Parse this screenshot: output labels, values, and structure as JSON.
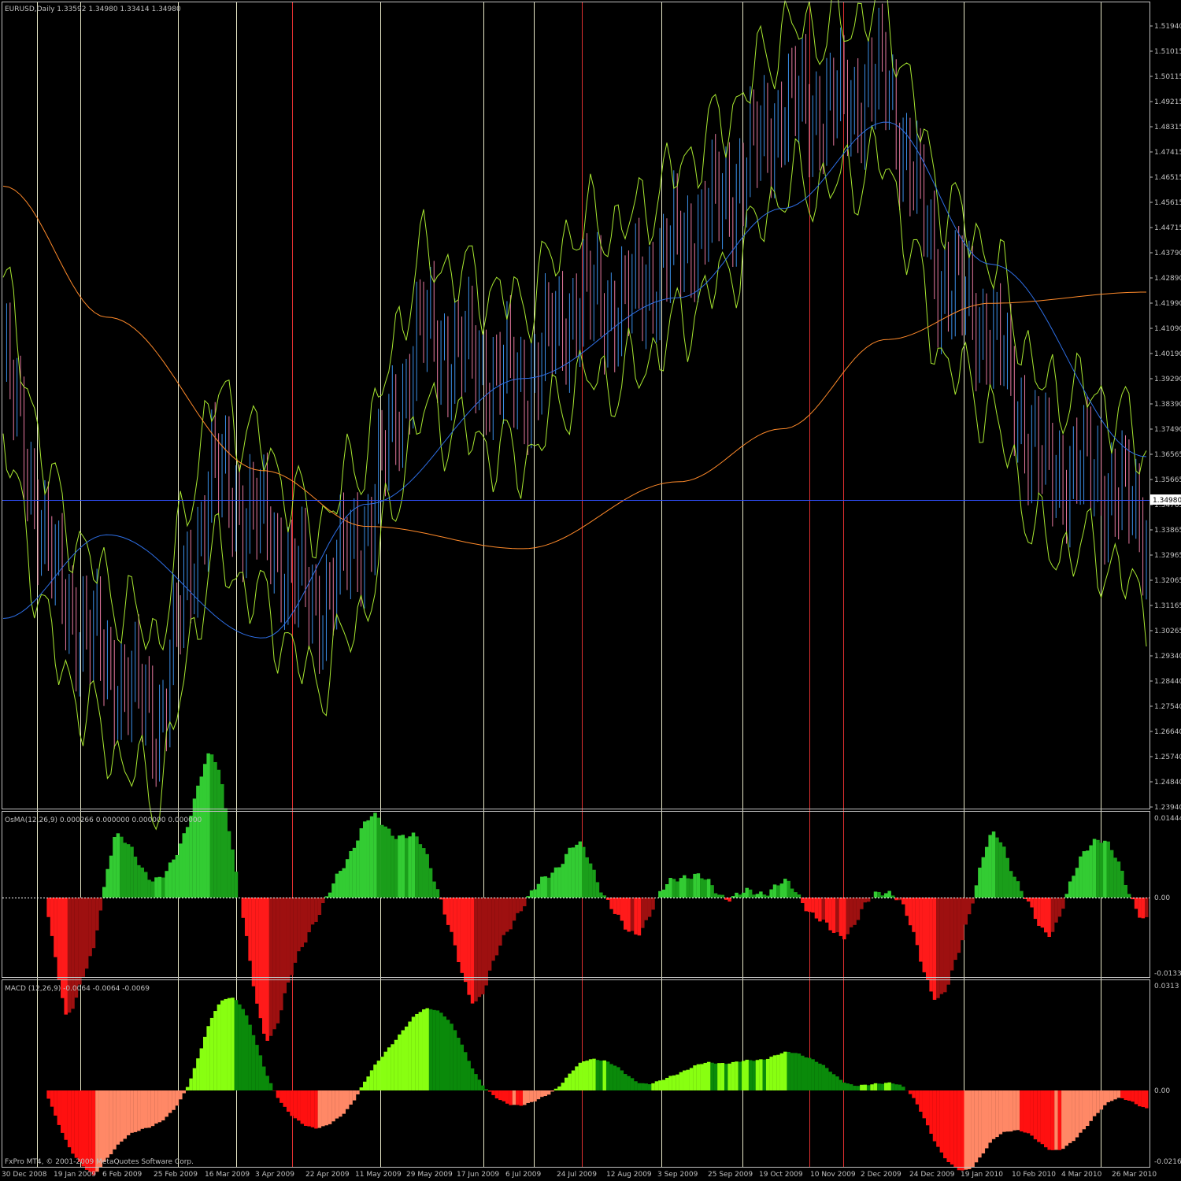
{
  "window": {
    "main_header": "EURUSD,Daily  1.33592 1.34980 1.33414 1.34980",
    "osma_header": "OsMA(12,26,9) 0.000266 0.000000 0.000000 0.000000",
    "macd_header": "MACD (12,26,9) -0.0064 -0.0064 -0.0069",
    "copyright": "FxPro MT4, © 2001-2009 MetaQuotes Software Corp.",
    "current_price": "1.34980"
  },
  "colors": {
    "background": "#000000",
    "frame": "#c0c0c0",
    "bull_candle": "#3b8fe8",
    "bear_candle": "#e87aa0",
    "envelope": "#a8e830",
    "ma_blue": "#2e6fe6",
    "ma_orange": "#ff8a2a",
    "vline_white": "#e8e8c8",
    "vline_red": "#e03030",
    "osma_pos": "#33cc33",
    "osma_pos_dark": "#1a9e1a",
    "osma_neg": "#ff1a1a",
    "osma_neg_dark": "#9e1010",
    "macd_pos": "#88ff11",
    "macd_pos_dark": "#0a8a0a",
    "macd_neg": "#ff1010",
    "macd_neg_light": "#ff8866",
    "price_line": "#3050ff"
  },
  "price_axis": [
    "1.51940",
    "1.51015",
    "1.50115",
    "1.49215",
    "1.48315",
    "1.47415",
    "1.46515",
    "1.45615",
    "1.44715",
    "1.43790",
    "1.42890",
    "1.41990",
    "1.41090",
    "1.40190",
    "1.39290",
    "1.38390",
    "1.37490",
    "1.36565",
    "1.35665",
    "1.34765",
    "1.33865",
    "1.32965",
    "1.32065",
    "1.31165",
    "1.30265",
    "1.29340",
    "1.28440",
    "1.27540",
    "1.26640",
    "1.25740",
    "1.24840",
    "1.23940"
  ],
  "osma_axis": [
    "0.01444",
    "0.00",
    "-0.01336"
  ],
  "macd_axis": [
    "0.0313",
    "0.00",
    "-0.0216"
  ],
  "time_axis": [
    "30 Dec 2008",
    "19 Jan 2009",
    "6 Feb 2009",
    "25 Feb 2009",
    "16 Mar 2009",
    "3 Apr 2009",
    "22 Apr 2009",
    "11 May 2009",
    "29 May 2009",
    "17 Jun 2009",
    "6 Jul 2009",
    "24 Jul 2009",
    "12 Aug 2009",
    "3 Sep 2009",
    "25 Sep 2009",
    "19 Oct 2009",
    "10 Nov 2009",
    "2 Dec 2009",
    "24 Dec 2009",
    "19 Jan 2010",
    "10 Feb 2010",
    "4 Mar 2010",
    "26 Mar 2010"
  ],
  "chart_data": {
    "type": "line",
    "title": "EURUSD,Daily",
    "ohlc_last": {
      "open": 1.33592,
      "high": 1.3498,
      "low": 1.33414,
      "close": 1.3498
    },
    "ylim": [
      1.2394,
      1.5194
    ],
    "close_path": {
      "dates": [
        "30 Dec 2008",
        "19 Jan 2009",
        "6 Feb 2009",
        "25 Feb 2009",
        "16 Mar 2009",
        "3 Apr 2009",
        "22 Apr 2009",
        "11 May 2009",
        "29 May 2009",
        "17 Jun 2009",
        "6 Jul 2009",
        "24 Jul 2009",
        "12 Aug 2009",
        "3 Sep 2009",
        "25 Sep 2009",
        "19 Oct 2009",
        "10 Nov 2009",
        "2 Dec 2009",
        "24 Dec 2009",
        "19 Jan 2010",
        "10 Feb 2010",
        "4 Mar 2010",
        "26 Mar 2010"
      ],
      "values": [
        1.4,
        1.32,
        1.29,
        1.27,
        1.36,
        1.34,
        1.31,
        1.34,
        1.41,
        1.4,
        1.39,
        1.42,
        1.42,
        1.44,
        1.46,
        1.49,
        1.49,
        1.5,
        1.43,
        1.41,
        1.36,
        1.36,
        1.34
      ]
    },
    "ma_blue": {
      "dates": [
        "30 Dec 2008",
        "6 Feb 2009",
        "3 Apr 2009",
        "11 May 2009",
        "6 Jul 2009",
        "3 Sep 2009",
        "19 Oct 2009",
        "2 Dec 2009",
        "19 Jan 2010",
        "26 Mar 2010"
      ],
      "values": [
        1.307,
        1.337,
        1.3,
        1.348,
        1.393,
        1.422,
        1.454,
        1.485,
        1.434,
        1.365
      ]
    },
    "ma_orange": {
      "dates": [
        "30 Dec 2008",
        "6 Feb 2009",
        "3 Apr 2009",
        "11 May 2009",
        "6 Jul 2009",
        "3 Sep 2009",
        "19 Oct 2009",
        "2 Dec 2009",
        "19 Jan 2010",
        "26 Mar 2010"
      ],
      "values": [
        1.462,
        1.415,
        1.36,
        1.34,
        1.332,
        1.356,
        1.375,
        1.407,
        1.42,
        1.424
      ]
    },
    "osma_range": [
      -0.01336,
      0.01444
    ],
    "macd_range": [
      -0.0216,
      0.0313
    ]
  }
}
